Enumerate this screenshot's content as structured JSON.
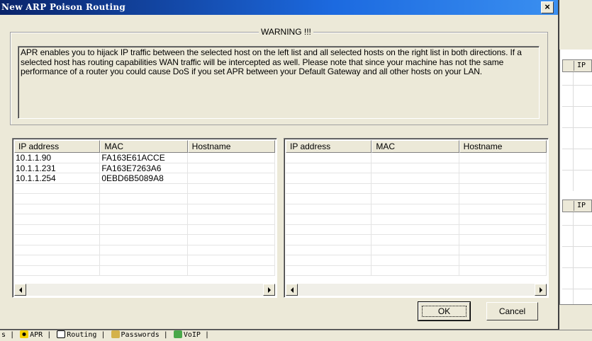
{
  "dialog": {
    "title": "New ARP Poison Routing",
    "close_label": "×",
    "warning_heading": "WARNING !!!",
    "warning_text": "APR enables you to hijack IP traffic between the selected host on the left list and all selected hosts on the right list in both directions. If a selected host has routing capabilities WAN traffic will be intercepted as well. Please note that since your machine has not the same performance of a router you could cause DoS if you set APR between your Default Gateway and all other hosts on your LAN.",
    "ok_label": "OK",
    "cancel_label": "Cancel"
  },
  "left_list": {
    "columns": [
      "IP address",
      "MAC",
      "Hostname"
    ],
    "rows": [
      {
        "ip": "10.1.1.90",
        "mac": "FA163E61ACCE",
        "hostname": ""
      },
      {
        "ip": "10.1.1.231",
        "mac": "FA163E7263A6",
        "hostname": ""
      },
      {
        "ip": "10.1.1.254",
        "mac": "0EBD6B5089A8",
        "hostname": ""
      }
    ]
  },
  "right_list": {
    "columns": [
      "IP address",
      "MAC",
      "Hostname"
    ],
    "rows": []
  },
  "background": {
    "col_header_1": "IP",
    "col_header_2": "IP",
    "tabs": [
      {
        "label": "s"
      },
      {
        "label": "APR",
        "icon": "radiation-icon"
      },
      {
        "label": "Routing",
        "icon": "routing-icon"
      },
      {
        "label": "Passwords",
        "icon": "key-icon"
      },
      {
        "label": "VoIP",
        "icon": "voip-icon"
      }
    ]
  },
  "colors": {
    "title_gradient_start": "#0a246a",
    "title_gradient_end": "#3a8ff0",
    "window_face": "#ece9d8"
  }
}
